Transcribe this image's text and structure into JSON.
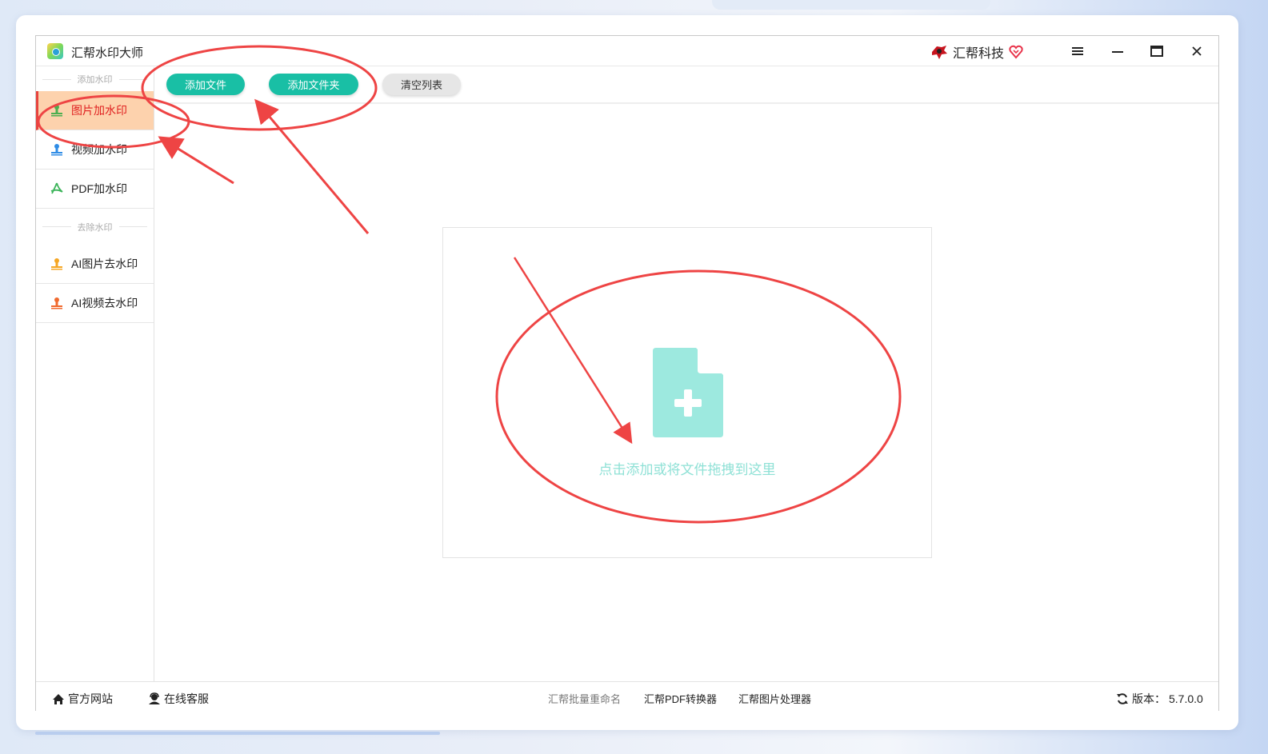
{
  "window": {
    "title": "汇帮水印大师",
    "brand": "汇帮科技"
  },
  "sidebar": {
    "add_section_label": "添加水印",
    "remove_section_label": "去除水印",
    "add_items": [
      {
        "label": "图片加水印",
        "icon": "image-stamp-icon",
        "color": "#4caf50",
        "active": true
      },
      {
        "label": "视频加水印",
        "icon": "video-stamp-icon",
        "color": "#2f8ce6",
        "active": false
      },
      {
        "label": "PDF加水印",
        "icon": "pdf-icon",
        "color": "#3cb45a",
        "active": false
      }
    ],
    "remove_items": [
      {
        "label": "AI图片去水印",
        "icon": "ai-image-stamp-icon",
        "color": "#f5a623"
      },
      {
        "label": "AI视频去水印",
        "icon": "ai-video-stamp-icon",
        "color": "#f06a2f"
      }
    ]
  },
  "toolbar": {
    "add_file": "添加文件",
    "add_folder": "添加文件夹",
    "clear_list": "清空列表"
  },
  "dropzone": {
    "hint": "点击添加或将文件拖拽到这里"
  },
  "footer": {
    "website": "官方网站",
    "support": "在线客服",
    "links": [
      "汇帮批量重命名",
      "汇帮PDF转换器",
      "汇帮图片处理器"
    ],
    "version_label": "版本：",
    "version": "5.7.0.0"
  },
  "colors": {
    "accent": "#19bfa5",
    "active_bg": "#fdd2ad",
    "active_text": "#e02020",
    "annotation": "#ee4444"
  }
}
